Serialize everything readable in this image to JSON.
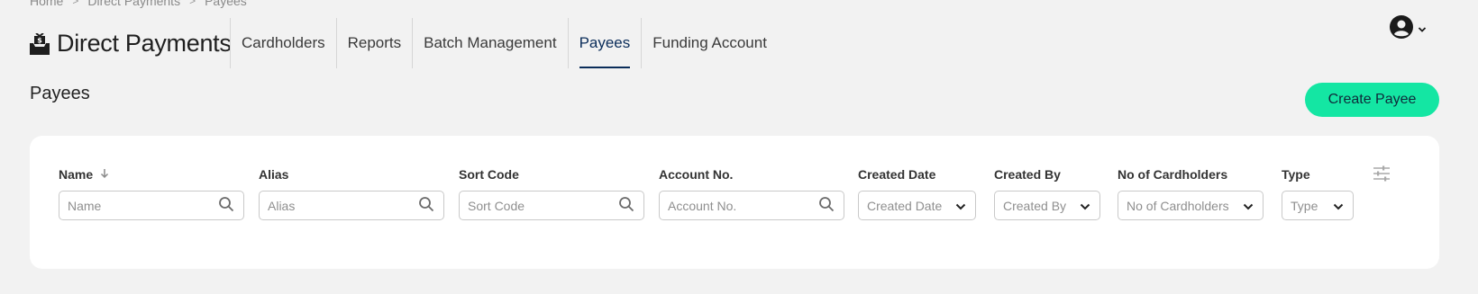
{
  "breadcrumb": {
    "items": [
      "Home",
      "Direct Payments",
      "Payees"
    ],
    "separator": ">"
  },
  "brand": {
    "title": "Direct Payments",
    "icon": "inbox-money-icon"
  },
  "nav": {
    "tabs": [
      {
        "label": "Cardholders",
        "active": false
      },
      {
        "label": "Reports",
        "active": false
      },
      {
        "label": "Batch Management",
        "active": false
      },
      {
        "label": "Payees",
        "active": true
      },
      {
        "label": "Funding Account",
        "active": false
      }
    ]
  },
  "user_menu": {
    "icon": "user-avatar-icon",
    "caret": "chevron-down-icon"
  },
  "page": {
    "title": "Payees"
  },
  "actions": {
    "create_label": "Create Payee"
  },
  "colors": {
    "accent": "#14e6a3",
    "active_tab": "#0b2d5a",
    "background": "#f2f2f2"
  },
  "table": {
    "columns": [
      {
        "header": "Name",
        "placeholder": "Name",
        "kind": "search",
        "sorted": "desc"
      },
      {
        "header": "Alias",
        "placeholder": "Alias",
        "kind": "search"
      },
      {
        "header": "Sort Code",
        "placeholder": "Sort Code",
        "kind": "search"
      },
      {
        "header": "Account No.",
        "placeholder": "Account No.",
        "kind": "search"
      },
      {
        "header": "Created Date",
        "placeholder": "Created Date",
        "kind": "select"
      },
      {
        "header": "Created By",
        "placeholder": "Created By",
        "kind": "select"
      },
      {
        "header": "No of Cardholders",
        "placeholder": "No of Cardholders",
        "kind": "select"
      },
      {
        "header": "Type",
        "placeholder": "Type",
        "kind": "select"
      }
    ],
    "settings_icon": "column-settings-icon"
  }
}
